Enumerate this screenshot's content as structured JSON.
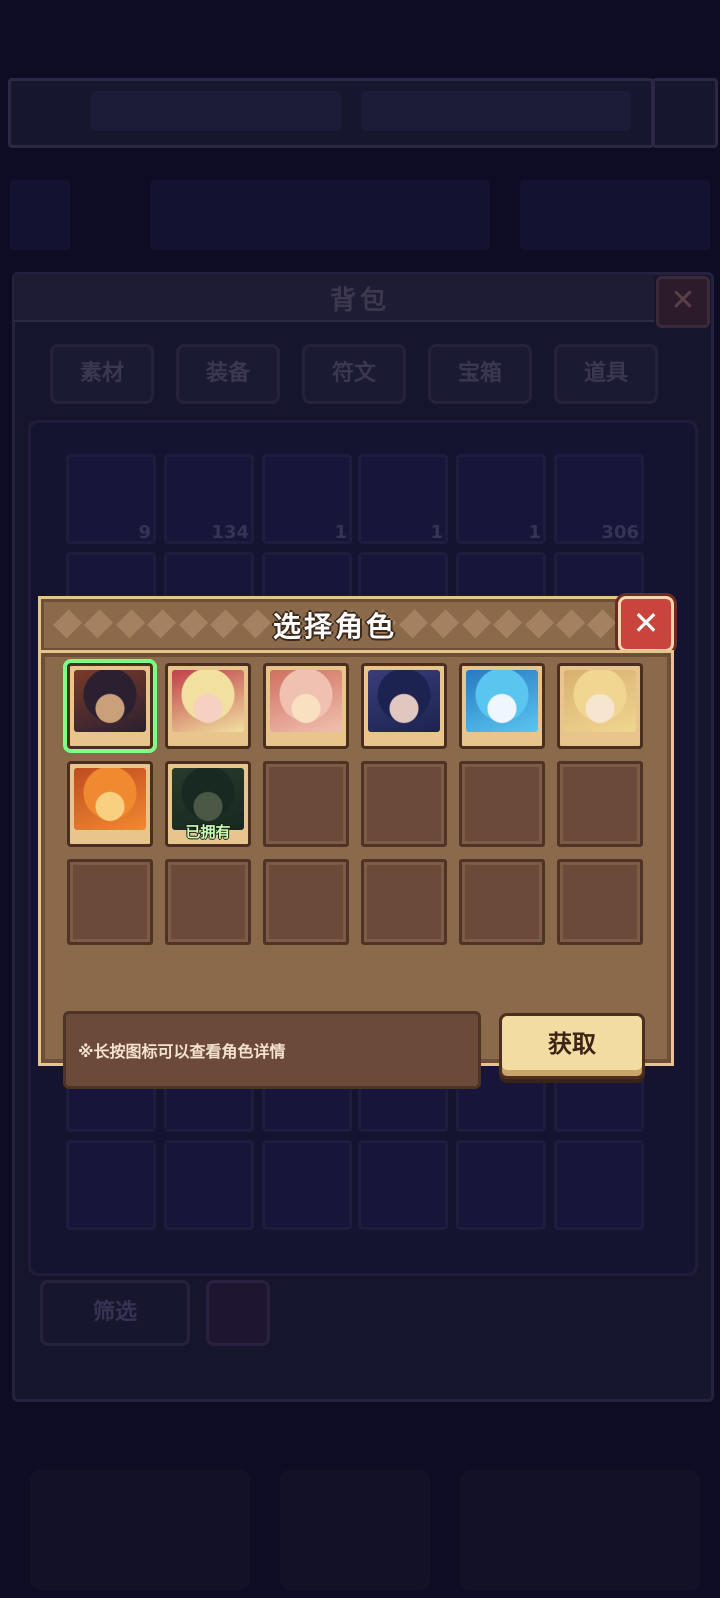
{
  "background": {
    "title": "背包",
    "tabs": [
      "素材",
      "装备",
      "符文",
      "宝箱",
      "道具"
    ],
    "item_counts": [
      "9",
      "134",
      "1",
      "1",
      "1",
      "306"
    ],
    "filter_label": "筛选"
  },
  "dialog": {
    "title": "选择角色",
    "close_label": "✕",
    "owned_label": "已拥有",
    "hint": "※长按图标可以查看角色详情",
    "get_button": "获取"
  },
  "characters": [
    {
      "id": "char-1",
      "selected": true,
      "owned": false,
      "colors": [
        "#2a2030",
        "#7a3a2a",
        "#c9a07a"
      ]
    },
    {
      "id": "char-2",
      "selected": false,
      "owned": false,
      "colors": [
        "#f1e0a0",
        "#c0404a",
        "#f6d0c0"
      ]
    },
    {
      "id": "char-3",
      "selected": false,
      "owned": false,
      "colors": [
        "#f0c0b0",
        "#d07060",
        "#f8e0c0"
      ]
    },
    {
      "id": "char-4",
      "selected": false,
      "owned": false,
      "colors": [
        "#1d2350",
        "#3a3c7a",
        "#e0c8c0"
      ]
    },
    {
      "id": "char-5",
      "selected": false,
      "owned": false,
      "colors": [
        "#5ac6f0",
        "#2a78c0",
        "#f0f6ff"
      ]
    },
    {
      "id": "char-6",
      "selected": false,
      "owned": false,
      "colors": [
        "#f0d690",
        "#d8b070",
        "#f6e6d0"
      ]
    },
    {
      "id": "char-7",
      "selected": false,
      "owned": false,
      "colors": [
        "#f08a30",
        "#c04a20",
        "#f8d080"
      ]
    },
    {
      "id": "char-8",
      "selected": false,
      "owned": true,
      "colors": [
        "#2a4a3a",
        "#4a6a50",
        "#8aa080"
      ]
    }
  ]
}
